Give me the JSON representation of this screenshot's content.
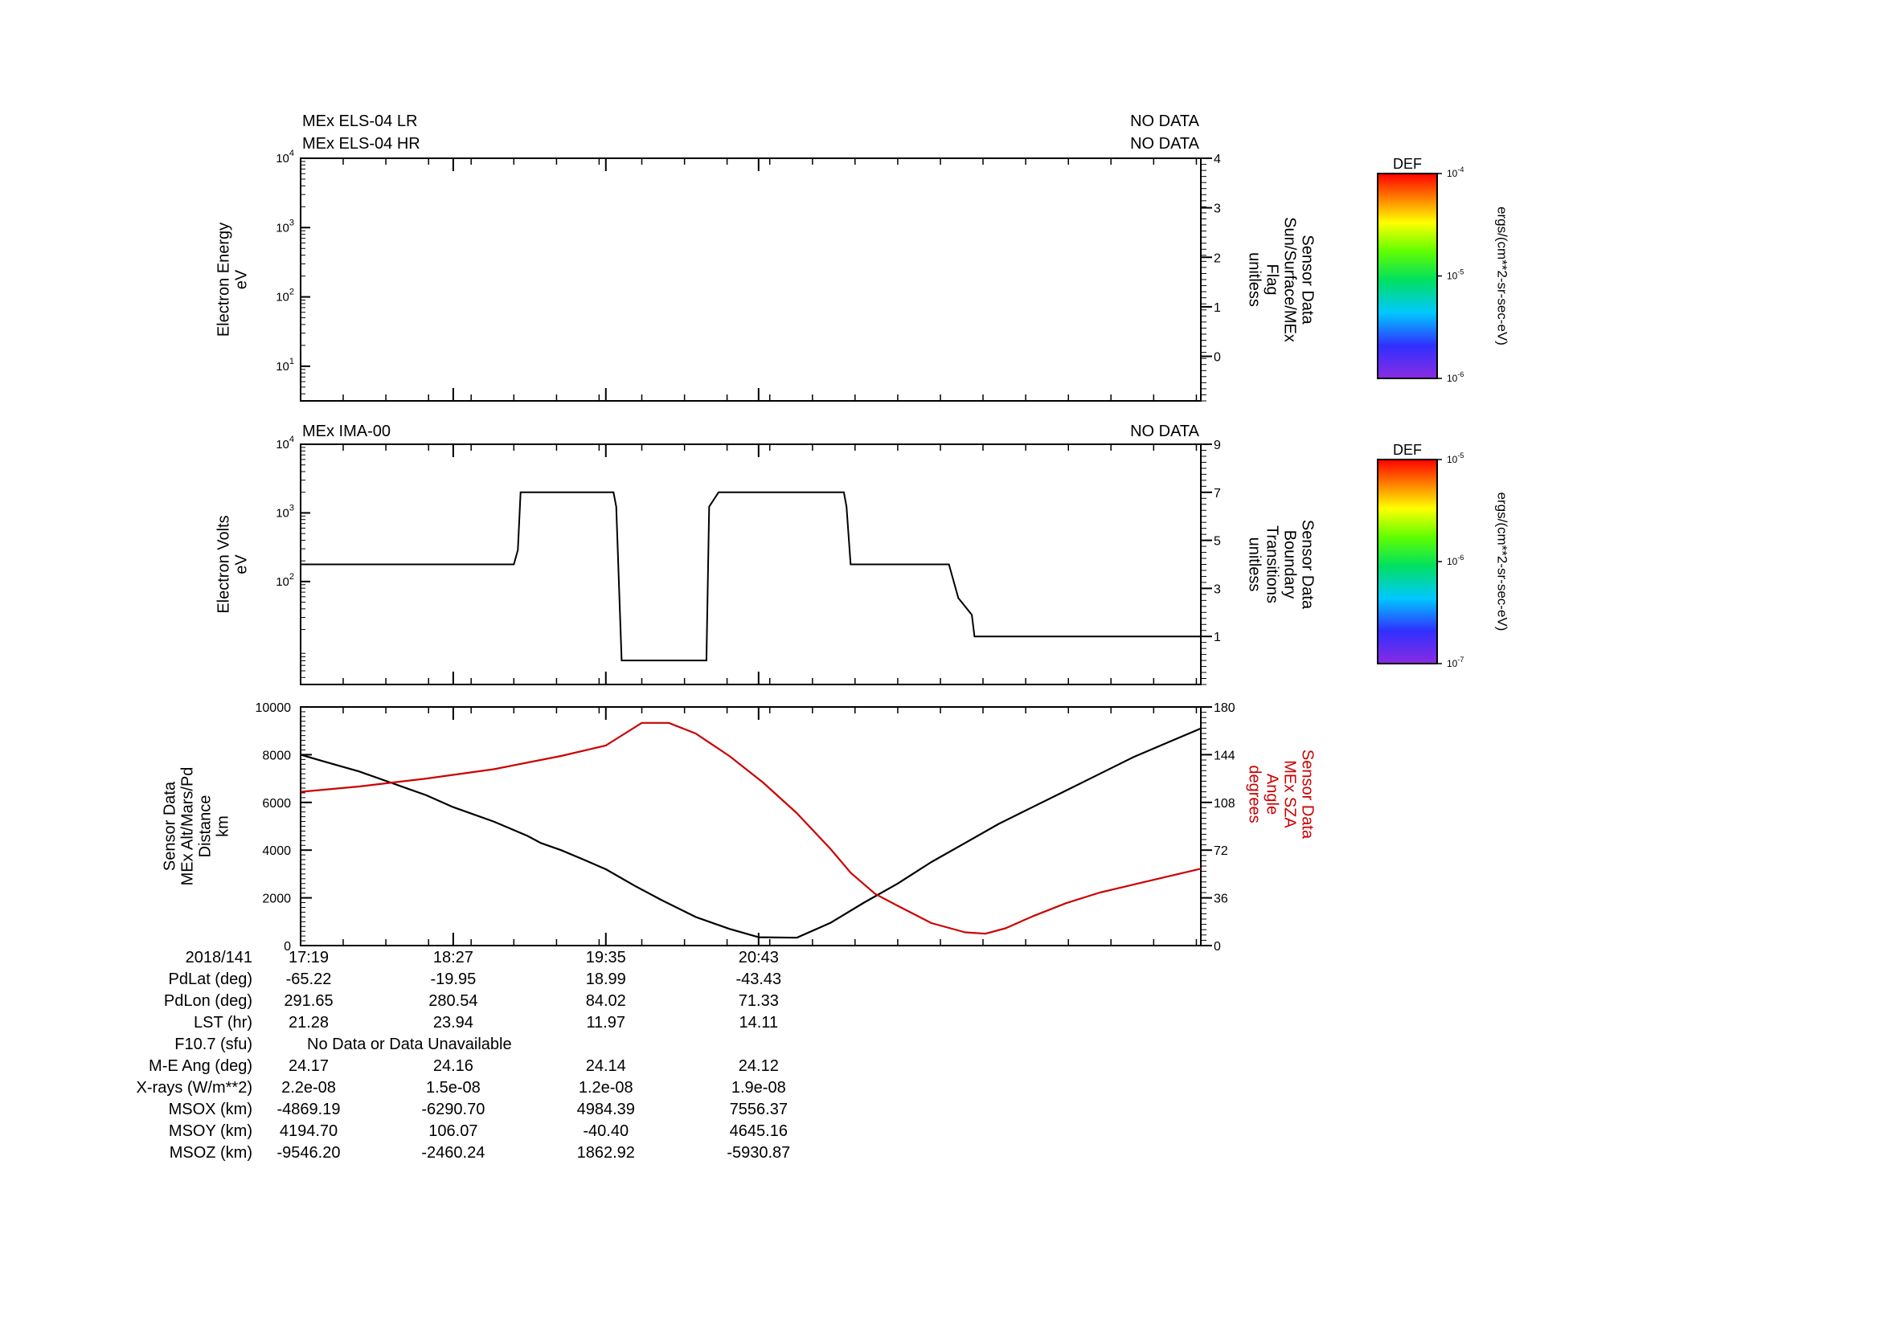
{
  "chart_data": [
    {
      "type": "line",
      "panel": "electron-spectrogram",
      "header_left": [
        "MEx ELS-04 LR",
        "MEx ELS-04 HR"
      ],
      "header_right": [
        "NO DATA",
        "NO DATA"
      ],
      "ylabel": [
        "Electron Energy",
        "eV"
      ],
      "y_scale": "log",
      "y_ticks": [
        {
          "exp": "1",
          "value": 10
        },
        {
          "exp": "2",
          "value": 100
        },
        {
          "exp": "3",
          "value": 1000
        },
        {
          "exp": "4",
          "value": 10000
        }
      ],
      "y2label": [
        "Sensor Data",
        "Sun/Surface/MEx",
        "Flag",
        "unitless"
      ],
      "y2_ticks": [
        "0",
        "1",
        "2",
        "3",
        "4"
      ],
      "y2lim": [
        -0.9,
        4
      ],
      "series": [],
      "colorbar": {
        "title": "DEF",
        "ticks": [
          {
            "base": "10",
            "exp": "-4"
          },
          {
            "base": "10",
            "exp": "-5"
          },
          {
            "base": "10",
            "exp": "-6"
          }
        ],
        "units": "ergs/(cm**2-sr-sec-eV)"
      }
    },
    {
      "type": "line",
      "panel": "ion-spectrogram",
      "header_left": [
        "MEx IMA-00"
      ],
      "header_right": [
        "NO DATA"
      ],
      "ylabel": [
        "Electron Volts",
        "eV"
      ],
      "y_scale": "log",
      "y_ticks": [
        {
          "exp": "2",
          "value": 100
        },
        {
          "exp": "3",
          "value": 1000
        },
        {
          "exp": "4",
          "value": 10000
        }
      ],
      "y2label": [
        "Sensor Data",
        "Boundary",
        "Transitions",
        "unitless"
      ],
      "y2_ticks": [
        "1",
        "3",
        "5",
        "7",
        "9"
      ],
      "y2lim": [
        -1,
        9
      ],
      "series": [
        {
          "color": "#000000",
          "x": [
            17.317,
            18.9,
            18.93,
            18.95,
            19.64,
            19.66,
            19.7,
            20.33,
            20.35,
            20.42,
            21.35,
            21.37,
            21.4,
            22.13,
            22.16,
            22.2,
            22.3,
            22.32,
            24.0
          ],
          "y": [
            4,
            4,
            4.6,
            7,
            7,
            6.4,
            0,
            0,
            6.4,
            7,
            7,
            6.4,
            4,
            4,
            3.4,
            2.6,
            1.9,
            1,
            1
          ]
        }
      ],
      "colorbar": {
        "title": "DEF",
        "ticks": [
          {
            "base": "10",
            "exp": "-5"
          },
          {
            "base": "10",
            "exp": "-6"
          },
          {
            "base": "10",
            "exp": "-7"
          }
        ],
        "units": "ergs/(cm**2-sr-sec-eV)"
      }
    },
    {
      "type": "line",
      "panel": "orbit",
      "ylabel": [
        "Sensor Data",
        "MEx Alt/Mars/Pd",
        "Distance",
        "km"
      ],
      "ylim": [
        0,
        10000
      ],
      "y_ticks": [
        "0",
        "2000",
        "4000",
        "6000",
        "8000",
        "10000"
      ],
      "y2label": [
        "Sensor Data",
        "MEx SZA",
        "Angle",
        "degrees"
      ],
      "y2lim": [
        0,
        180
      ],
      "y2_ticks": [
        "0",
        "36",
        "72",
        "108",
        "144",
        "180"
      ],
      "accent_color": "#cc0000",
      "series": [
        {
          "color": "#000000",
          "axis": "left",
          "x": [
            17.317,
            17.5,
            17.75,
            18.0,
            18.25,
            18.45,
            18.75,
            19.0,
            19.1,
            19.25,
            19.42,
            19.583,
            19.8,
            20.0,
            20.25,
            20.5,
            20.717,
            21.0,
            21.25,
            21.5,
            21.75,
            22.0,
            22.25,
            22.5,
            22.75,
            23.0,
            23.25,
            23.5,
            23.75,
            24.0
          ],
          "y": [
            8000,
            7700,
            7300,
            6800,
            6300,
            5800,
            5200,
            4600,
            4300,
            4000,
            3600,
            3200,
            2500,
            1900,
            1200,
            700,
            350,
            330,
            950,
            1800,
            2600,
            3500,
            4300,
            5100,
            5800,
            6500,
            7200,
            7900,
            8500,
            9100
          ]
        },
        {
          "color": "#cc0000",
          "axis": "right",
          "x": [
            17.317,
            17.75,
            18.25,
            18.75,
            19.25,
            19.583,
            19.85,
            20.05,
            20.25,
            20.5,
            20.75,
            21.0,
            21.25,
            21.4,
            21.583,
            21.75,
            22.0,
            22.25,
            22.4,
            22.55,
            22.75,
            23.0,
            23.25,
            23.5,
            23.75,
            24.0
          ],
          "y": [
            116,
            120,
            126,
            133,
            143,
            151,
            168,
            168,
            160,
            143,
            123,
            100,
            73,
            55,
            39,
            30,
            17,
            10,
            9,
            13,
            22,
            32,
            40,
            46,
            52,
            58
          ]
        }
      ]
    }
  ],
  "x_axis": {
    "range_hours": [
      17.317,
      24.0
    ],
    "major_ticks_hours": [
      17.317,
      18.45,
      19.583,
      20.717
    ],
    "minor_ticks_hours": [
      17.317,
      17.633,
      17.95,
      18.267,
      18.583,
      18.9,
      19.217,
      19.533,
      19.85,
      20.167,
      20.483,
      20.8,
      21.117,
      21.433,
      21.75,
      22.067,
      22.383,
      22.7,
      23.017,
      23.333,
      23.65,
      23.967
    ],
    "tick_labels": [
      "17:19",
      "18:27",
      "19:35",
      "20:43"
    ]
  },
  "ephemeris": {
    "date_label": "2018/141",
    "rows": [
      {
        "label": "PdLat (deg)",
        "values": [
          "-65.22",
          "-19.95",
          "18.99",
          "-43.43"
        ]
      },
      {
        "label": "PdLon (deg)",
        "values": [
          "291.65",
          "280.54",
          "84.02",
          "71.33"
        ]
      },
      {
        "label": "LST (hr)",
        "values": [
          "21.28",
          "23.94",
          "11.97",
          "14.11"
        ]
      },
      {
        "label": "F10.7 (sfu)",
        "note": "No Data or Data Unavailable"
      },
      {
        "label": "M-E Ang (deg)",
        "values": [
          "24.17",
          "24.16",
          "24.14",
          "24.12"
        ]
      },
      {
        "label": "X-rays (W/m**2)",
        "values": [
          "2.2e-08",
          "1.5e-08",
          "1.2e-08",
          "1.9e-08"
        ]
      },
      {
        "label": "MSOX (km)",
        "values": [
          "-4869.19",
          "-6290.70",
          "4984.39",
          "7556.37"
        ]
      },
      {
        "label": "MSOY (km)",
        "values": [
          "4194.70",
          "106.07",
          "-40.40",
          "4645.16"
        ]
      },
      {
        "label": "MSOZ (km)",
        "values": [
          "-9546.20",
          "-2460.24",
          "1862.92",
          "-5930.87"
        ]
      }
    ]
  }
}
